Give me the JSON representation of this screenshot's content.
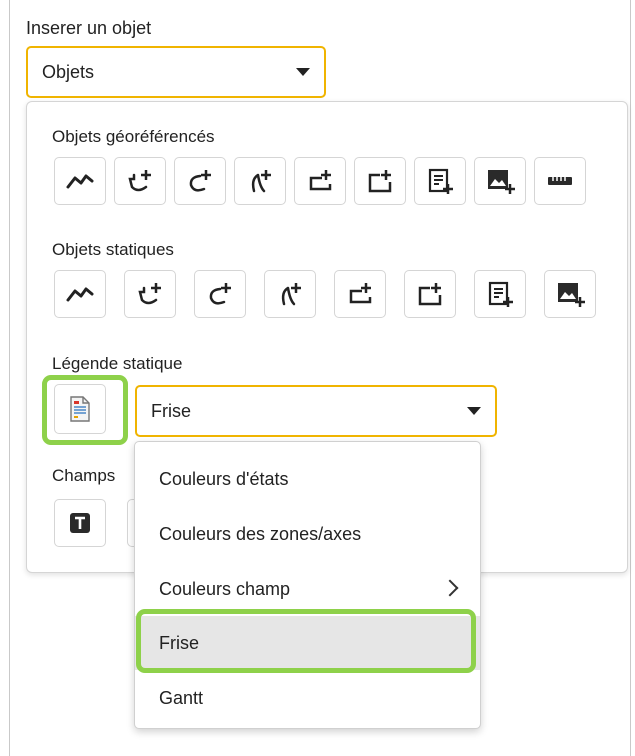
{
  "title": "Inserer un objet",
  "main_select": {
    "value": "Objets"
  },
  "sections": {
    "geo": {
      "label": "Objets géoréférencés",
      "icons": [
        "trend-line-icon",
        "arc-add-icon",
        "curve-add-icon",
        "curve-add-alt-icon",
        "rect-add-icon",
        "rect-corner-add-icon",
        "text-add-icon",
        "image-add-icon",
        "ruler-icon"
      ]
    },
    "static": {
      "label": "Objets statiques",
      "icons": [
        "trend-line-icon",
        "arc-add-icon",
        "curve-add-icon",
        "curve-add-alt-icon",
        "rect-add-icon",
        "rect-corner-add-icon",
        "text-add-icon",
        "image-add-icon"
      ]
    },
    "legend": {
      "label": "Légende statique",
      "select_value": "Frise",
      "icon": "legend-document-icon"
    },
    "fields": {
      "label": "Champs",
      "icon": "text-field-icon"
    }
  },
  "dropdown": {
    "items": [
      {
        "label": "Couleurs d'états",
        "submenu": false
      },
      {
        "label": "Couleurs des zones/axes",
        "submenu": false
      },
      {
        "label": "Couleurs champ",
        "submenu": true
      },
      {
        "label": "Frise",
        "submenu": false,
        "selected": true
      },
      {
        "label": "Gantt",
        "submenu": false
      }
    ]
  },
  "colors": {
    "accent_border": "#f0b400",
    "highlight": "#8ed14a",
    "selected_bg": "#e6e6e6"
  }
}
